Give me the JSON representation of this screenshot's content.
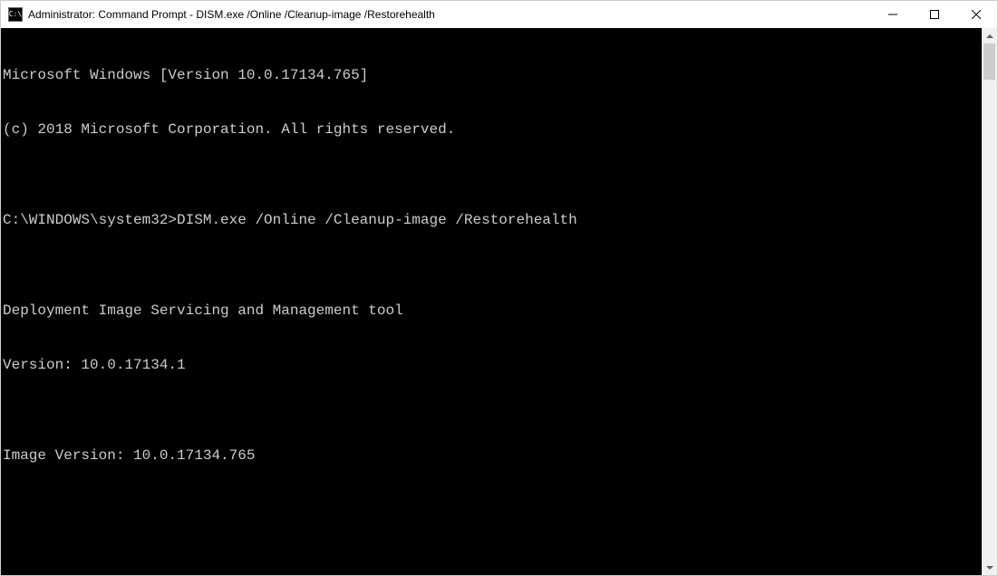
{
  "window": {
    "title": "Administrator: Command Prompt - DISM.exe  /Online /Cleanup-image /Restorehealth",
    "icon_label": "C:\\"
  },
  "terminal": {
    "lines": [
      "Microsoft Windows [Version 10.0.17134.765]",
      "(c) 2018 Microsoft Corporation. All rights reserved.",
      "",
      "C:\\WINDOWS\\system32>DISM.exe /Online /Cleanup-image /Restorehealth",
      "",
      "Deployment Image Servicing and Management tool",
      "Version: 10.0.17134.1",
      "",
      "Image Version: 10.0.17134.765",
      ""
    ]
  }
}
